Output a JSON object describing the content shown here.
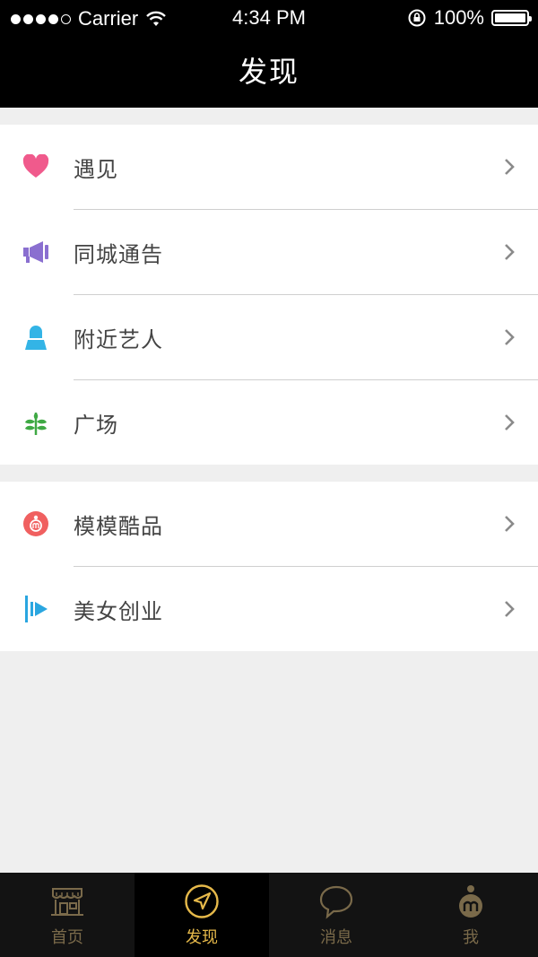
{
  "status_bar": {
    "carrier": "Carrier",
    "time": "4:34 PM",
    "battery": "100%"
  },
  "nav": {
    "title": "发现"
  },
  "groups": [
    {
      "items": [
        {
          "label": "遇见",
          "icon": "heart-icon",
          "color": "#f05a8c"
        },
        {
          "label": "同城通告",
          "icon": "megaphone-icon",
          "color": "#8a6fd0"
        },
        {
          "label": "附近艺人",
          "icon": "person-icon",
          "color": "#33b4e6"
        },
        {
          "label": "广场",
          "icon": "sprout-icon",
          "color": "#3fa944"
        }
      ]
    },
    {
      "items": [
        {
          "label": "模模酷品",
          "icon": "m-badge-icon",
          "color": "#f06060"
        },
        {
          "label": "美女创业",
          "icon": "play-flag-icon",
          "color": "#2aa6e0"
        }
      ]
    }
  ],
  "tabbar": {
    "tabs": [
      {
        "label": "首页",
        "icon": "storefront-icon",
        "active": false
      },
      {
        "label": "发现",
        "icon": "compass-icon",
        "active": true
      },
      {
        "label": "消息",
        "icon": "chat-bubble-icon",
        "active": false
      },
      {
        "label": "我",
        "icon": "m-profile-icon",
        "active": false
      }
    ],
    "active_color": "#e6b94a",
    "inactive_color": "#7a6a4a"
  }
}
